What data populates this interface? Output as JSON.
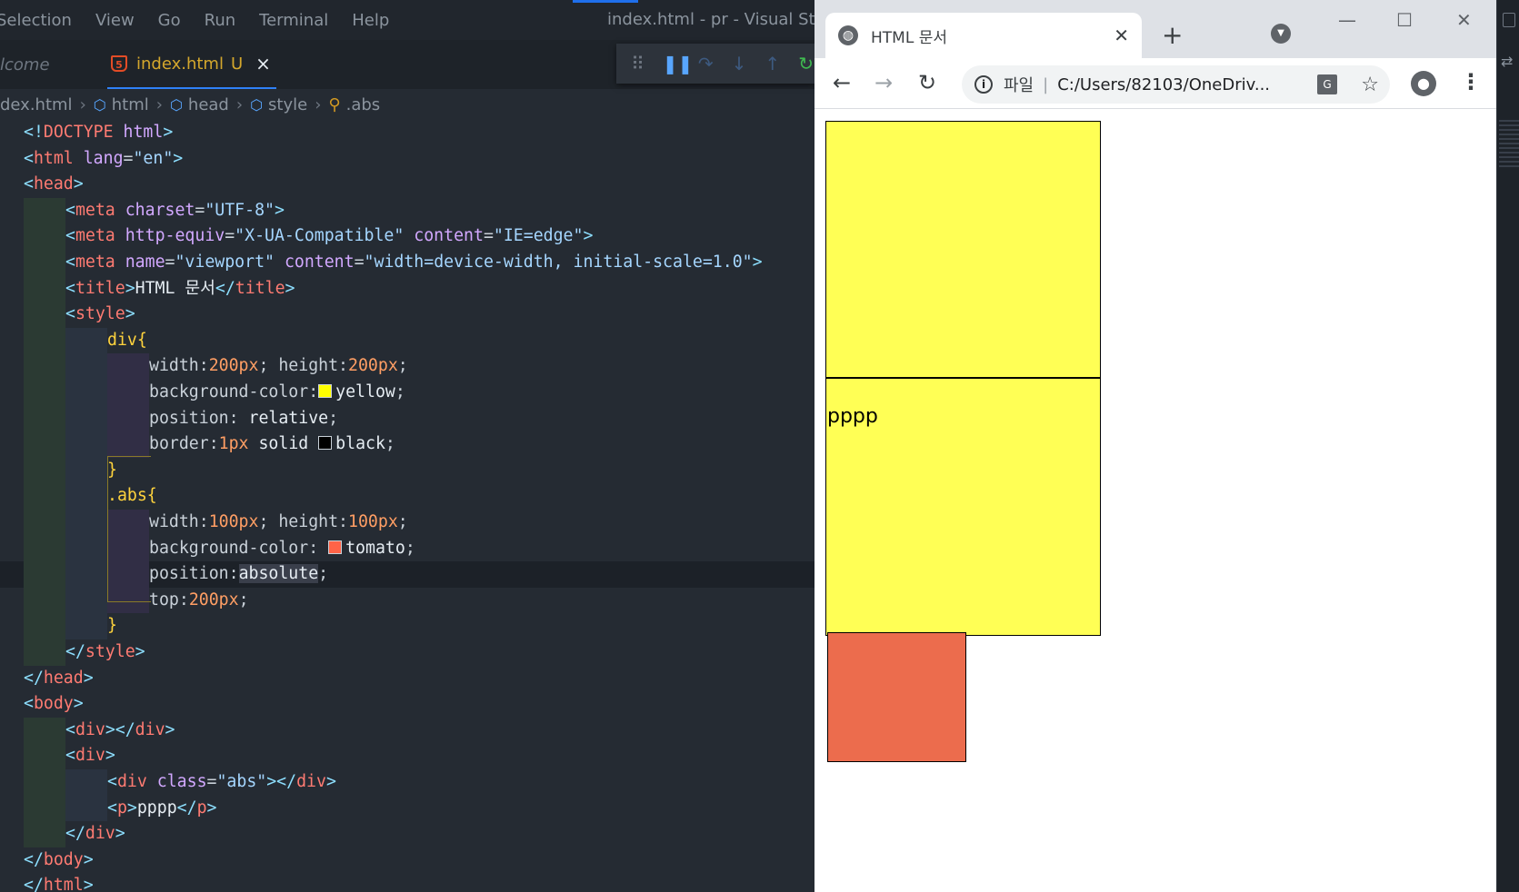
{
  "vscode": {
    "menu": [
      "Selection",
      "View",
      "Go",
      "Run",
      "Terminal",
      "Help"
    ],
    "window_title": "index.html - pr - Visual Studi",
    "tabs": {
      "welcome": "lcome",
      "active": "index.html",
      "active_status": "U",
      "close": "×"
    },
    "breadcrumb": {
      "file": "dex.html",
      "items": [
        "html",
        "head",
        "style",
        ".abs"
      ]
    },
    "code_lines": [
      "<!DOCTYPE html>",
      "<html lang=\"en\">",
      "<head>",
      "<meta charset=\"UTF-8\">",
      "<meta http-equiv=\"X-UA-Compatible\" content=\"IE=edge\">",
      "<meta name=\"viewport\" content=\"width=device-width, initial-scale=1.0\">",
      "<title>HTML 문서</title>",
      "<style>",
      "div{",
      "width:200px; height:200px;",
      "background-color: yellow;",
      "position: relative;",
      "border:1px solid  black;",
      "}",
      ".abs{",
      "width:100px; height:100px;",
      "background-color:  tomato;",
      "position:absolute;",
      "top:200px;",
      "}",
      "</style>",
      "</head>",
      "<body>",
      "<div></div>",
      "<div>",
      "<div class=\"abs\"></div>",
      "<p>pppp</p>",
      "</div>",
      "</body>",
      "</html>"
    ],
    "swatch_colors": {
      "yellow": "#ffff00",
      "black": "#000000",
      "tomato": "#ff6347"
    }
  },
  "browser": {
    "tab_title": "HTML 문서",
    "tab_close": "✕",
    "new_tab": "+",
    "address_scheme": "파일",
    "address_url": "C:/Users/82103/OneDriv...",
    "page": {
      "paragraph": "pppp",
      "box_color": "#ffff55",
      "abs_color": "#ec6c4d"
    }
  }
}
